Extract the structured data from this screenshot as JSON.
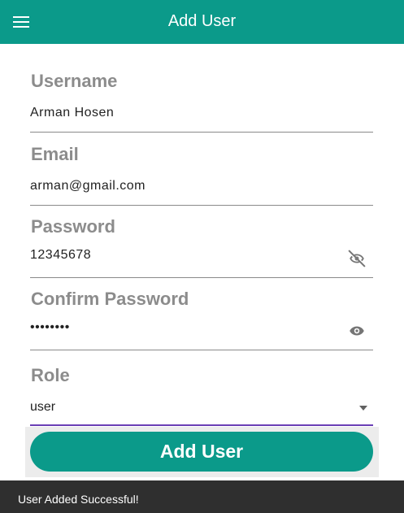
{
  "appbar": {
    "title": "Add User",
    "menu_icon": "menu-icon",
    "background": "#0b9a8a"
  },
  "form": {
    "username": {
      "label": "Username",
      "value": "Arman Hosen"
    },
    "email": {
      "label": "Email",
      "value": "arman@gmail.com"
    },
    "password": {
      "label": "Password",
      "value": "12345678",
      "toggle_icon": "visibility-off-icon"
    },
    "confirm_password": {
      "label": "Confirm Password",
      "value": "••••••••",
      "toggle_icon": "visibility-icon"
    },
    "role": {
      "label": "Role",
      "value": "user",
      "caret_icon": "arrow-drop-down-icon",
      "focus_color": "#6a3fb5"
    }
  },
  "submit": {
    "label": "Add User",
    "color": "#0b9a8a"
  },
  "snackbar": {
    "message": "User Added Successful!"
  }
}
